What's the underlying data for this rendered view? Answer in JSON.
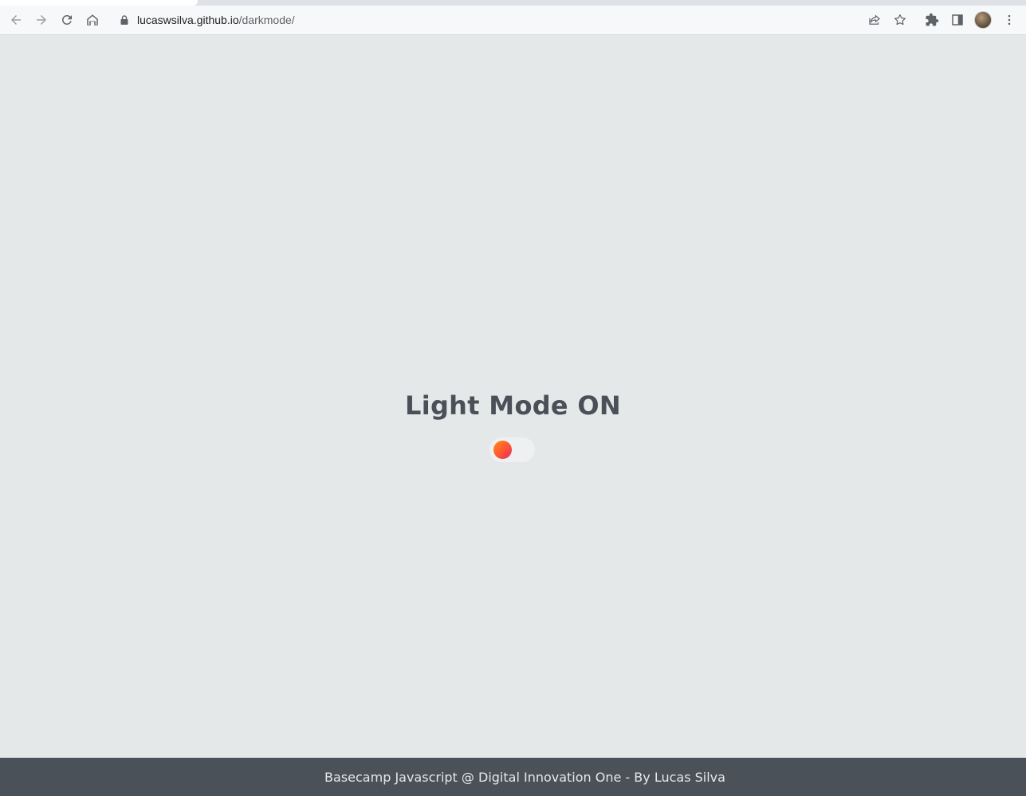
{
  "browser": {
    "url_host": "lucaswsilva.github.io",
    "url_path": "/darkmode/",
    "icons": [
      "back-arrow-icon",
      "forward-arrow-icon",
      "reload-icon",
      "home-icon",
      "lock-icon",
      "share-icon",
      "star-icon",
      "extensions-icon",
      "side-panel-icon",
      "kebab-menu-icon"
    ]
  },
  "page": {
    "title": "Light Mode ON",
    "toggle_state": "light",
    "footer_text": "Basecamp Javascript @ Digital Innovation One - By Lucas Silva"
  },
  "colors": {
    "background": "#e5e8e9",
    "title": "#4b5058",
    "footer_bg": "#4b5159",
    "knob_gradient_start": "#ff8c1a",
    "knob_gradient_end": "#e8266b"
  }
}
